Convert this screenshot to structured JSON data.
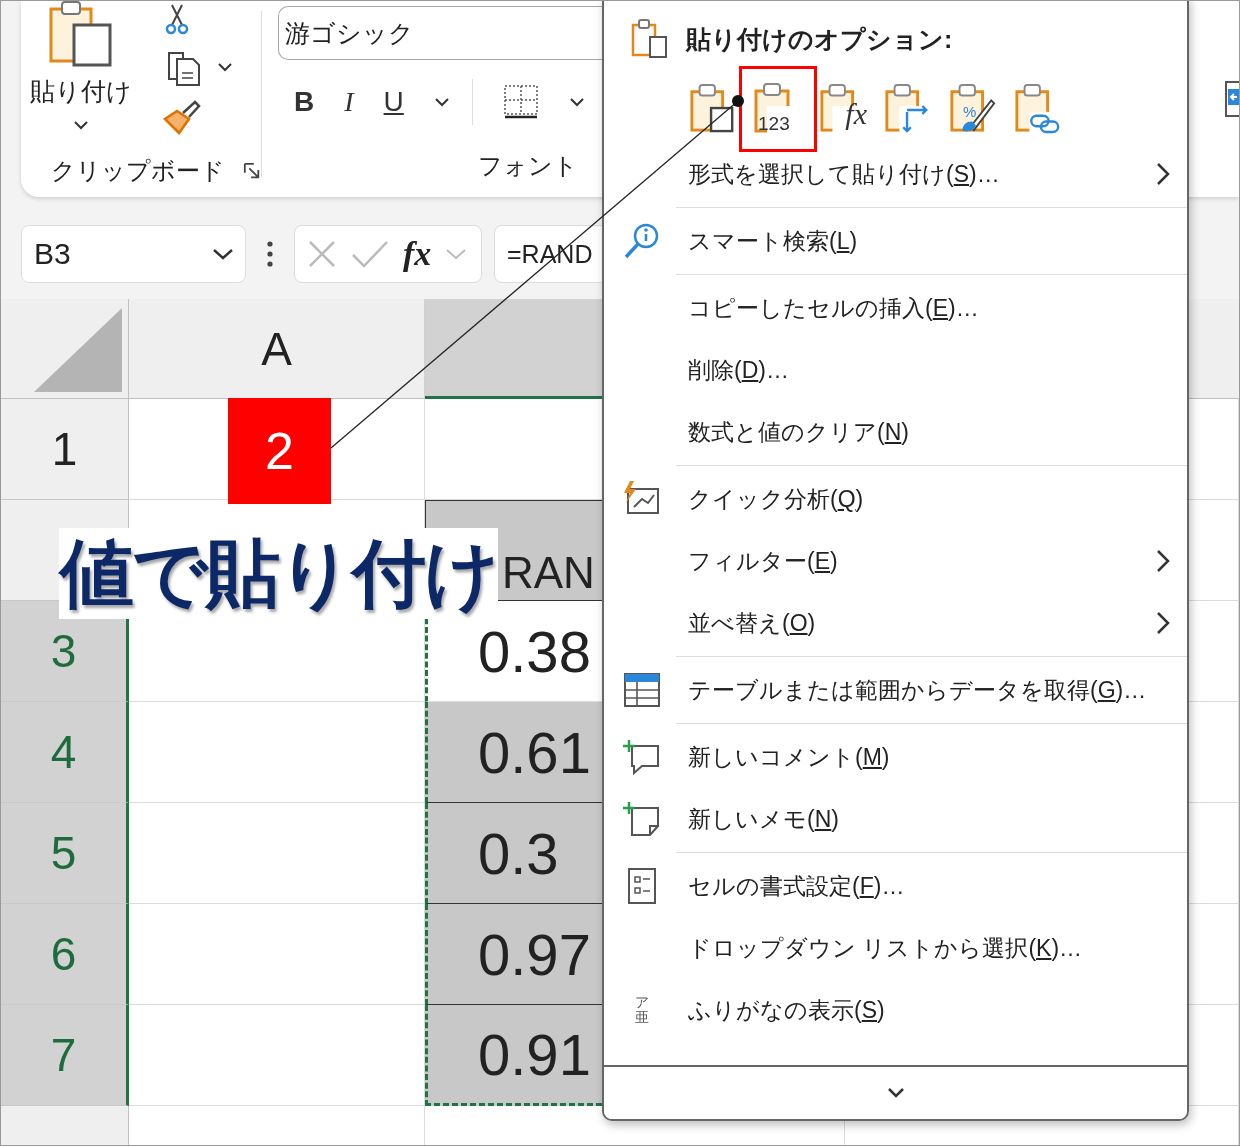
{
  "ribbon": {
    "clipboard": {
      "paste_label": "貼り付け",
      "title": "クリップボード"
    },
    "font": {
      "font_name": "游ゴシック",
      "bold": "B",
      "italic": "I",
      "underline": "U",
      "title": "フォント"
    }
  },
  "formula_bar": {
    "name_box": "B3",
    "fx": "fx",
    "formula": "=RAND"
  },
  "sheet": {
    "columns": [
      {
        "label": "A",
        "selected": false
      },
      {
        "selected": true
      }
    ],
    "rows": [
      {
        "number": "1",
        "selected": false
      },
      {
        "selected": false,
        "b": {
          "text": "RAN",
          "kind": "header",
          "active": false,
          "copied": false
        }
      },
      {
        "number": "3",
        "selected": true,
        "b": {
          "text": "0.38",
          "kind": "value",
          "active": true,
          "copied": true
        }
      },
      {
        "number": "4",
        "selected": true,
        "b": {
          "text": "0.61",
          "kind": "value",
          "active": false,
          "copied": true
        }
      },
      {
        "number": "5",
        "selected": true,
        "b": {
          "text": "0.3",
          "kind": "value",
          "active": false,
          "copied": true
        }
      },
      {
        "number": "6",
        "selected": true,
        "b": {
          "text": "0.97",
          "kind": "value",
          "active": false,
          "copied": true
        }
      },
      {
        "number": "7",
        "selected": true,
        "b": {
          "text": "0.91",
          "kind": "value",
          "active": false,
          "copied": true
        }
      },
      {
        "selected": false
      }
    ]
  },
  "annotation": {
    "step": "2",
    "callout": "値で貼り付け"
  },
  "context_menu": {
    "header": "貼り付けのオプション:",
    "paste_options": [
      {
        "kind": "keep",
        "highlighted": false
      },
      {
        "kind": "values",
        "glyph": "123",
        "highlighted": true
      },
      {
        "kind": "formulas",
        "glyph": "fx",
        "highlighted": false
      },
      {
        "kind": "transpose",
        "highlighted": false
      },
      {
        "kind": "formatting",
        "glyph": "%",
        "highlighted": false
      },
      {
        "kind": "link",
        "highlighted": false
      }
    ],
    "items": [
      {
        "kind": "plain",
        "pre": "形式を選択して貼り付け(",
        "key": "S",
        "post": ")…",
        "submenu": true
      },
      {
        "kind": "separator"
      },
      {
        "kind": "search",
        "pre": "スマート検索(",
        "key": "L",
        "post": ")",
        "submenu": false
      },
      {
        "kind": "separator"
      },
      {
        "kind": "plain",
        "pre": "コピーしたセルの挿入(",
        "key": "E",
        "post": ")…",
        "submenu": false
      },
      {
        "kind": "plain",
        "pre": "削除(",
        "key": "D",
        "post": ")…",
        "submenu": false
      },
      {
        "kind": "plain",
        "pre": "数式と値のクリア(",
        "key": "N",
        "post": ")",
        "submenu": false
      },
      {
        "kind": "separator"
      },
      {
        "kind": "quick",
        "pre": "クイック分析(",
        "key": "Q",
        "post": ")",
        "submenu": false
      },
      {
        "kind": "plain",
        "pre": "フィルター(",
        "key": "E",
        "post": ")",
        "submenu": true
      },
      {
        "kind": "plain",
        "pre": "並べ替え(",
        "key": "O",
        "post": ")",
        "submenu": true
      },
      {
        "kind": "separator"
      },
      {
        "kind": "table",
        "pre": "テーブルまたは範囲からデータを取得(",
        "key": "G",
        "post": ")…",
        "submenu": false
      },
      {
        "kind": "separator"
      },
      {
        "kind": "comment",
        "pre": "新しいコメント(",
        "key": "M",
        "post": ")",
        "submenu": false
      },
      {
        "kind": "note",
        "pre": "新しいメモ(",
        "key": "N",
        "post": ")",
        "submenu": false
      },
      {
        "kind": "separator"
      },
      {
        "kind": "format",
        "pre": "セルの書式設定(",
        "key": "F",
        "post": ")…",
        "submenu": false
      },
      {
        "kind": "plain",
        "pre": "ドロップダウン リストから選択(",
        "key": "K",
        "post": ")…",
        "submenu": false
      },
      {
        "kind": "furigana",
        "glyph": "ア亜",
        "pre": "ふりがなの表示(",
        "key": "S",
        "post": ")",
        "submenu": false
      }
    ]
  }
}
